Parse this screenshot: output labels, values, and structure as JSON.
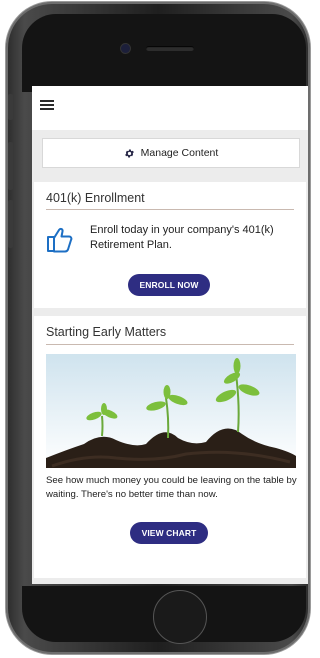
{
  "header": {
    "menu_icon": "hamburger-icon"
  },
  "manage": {
    "label": "Manage Content",
    "icon": "gear-icon"
  },
  "enrollment": {
    "title": "401(k) Enrollment",
    "icon": "thumbs-up-icon",
    "text": "Enroll today in your company's 401(k) Retirement Plan.",
    "button": "ENROLL NOW"
  },
  "early": {
    "title": "Starting Early Matters",
    "image": "sprouts-image",
    "text": "See how much money you could be leaving on the table by waiting. There's no better time than now.",
    "button": "VIEW CHART"
  },
  "colors": {
    "accent": "#2e2d82",
    "thumb": "#1d6fc4"
  }
}
